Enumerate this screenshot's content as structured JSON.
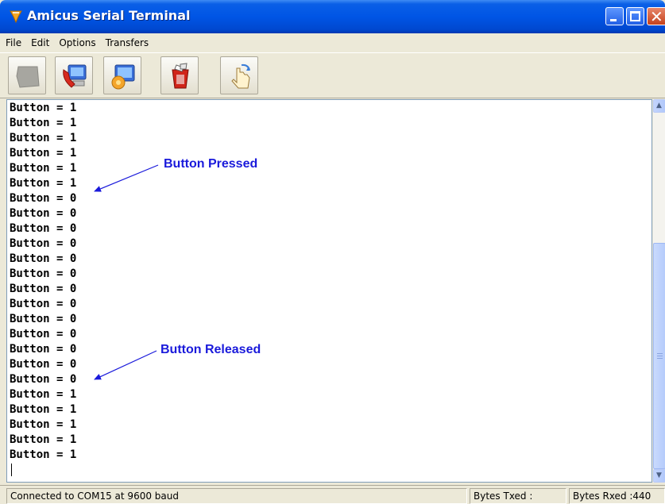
{
  "window": {
    "title": "Amicus Serial Terminal"
  },
  "menu": {
    "items": [
      "File",
      "Edit",
      "Options",
      "Transfers"
    ]
  },
  "toolbar": {
    "buttons": [
      "disconnect-icon",
      "connect-phone-icon",
      "settings-icon",
      "clear-icon",
      "hand-icon"
    ]
  },
  "terminal": {
    "lines": [
      "Button = 1",
      "Button = 1",
      "Button = 1",
      "Button = 1",
      "Button = 1",
      "Button = 1",
      "Button = 0",
      "Button = 0",
      "Button = 0",
      "Button = 0",
      "Button = 0",
      "Button = 0",
      "Button = 0",
      "Button = 0",
      "Button = 0",
      "Button = 0",
      "Button = 0",
      "Button = 0",
      "Button = 0",
      "Button = 1",
      "Button = 1",
      "Button = 1",
      "Button = 1",
      "Button = 1"
    ],
    "annotations": {
      "pressed": "Button Pressed",
      "released": "Button Released"
    }
  },
  "status": {
    "connection": "Connected to COM15 at 9600 baud",
    "bytes_txed": "Bytes Txed :",
    "bytes_rxed": "Bytes Rxed :440"
  },
  "colors": {
    "annotation": "#1a1adb",
    "titlebar": "#0055e5"
  }
}
